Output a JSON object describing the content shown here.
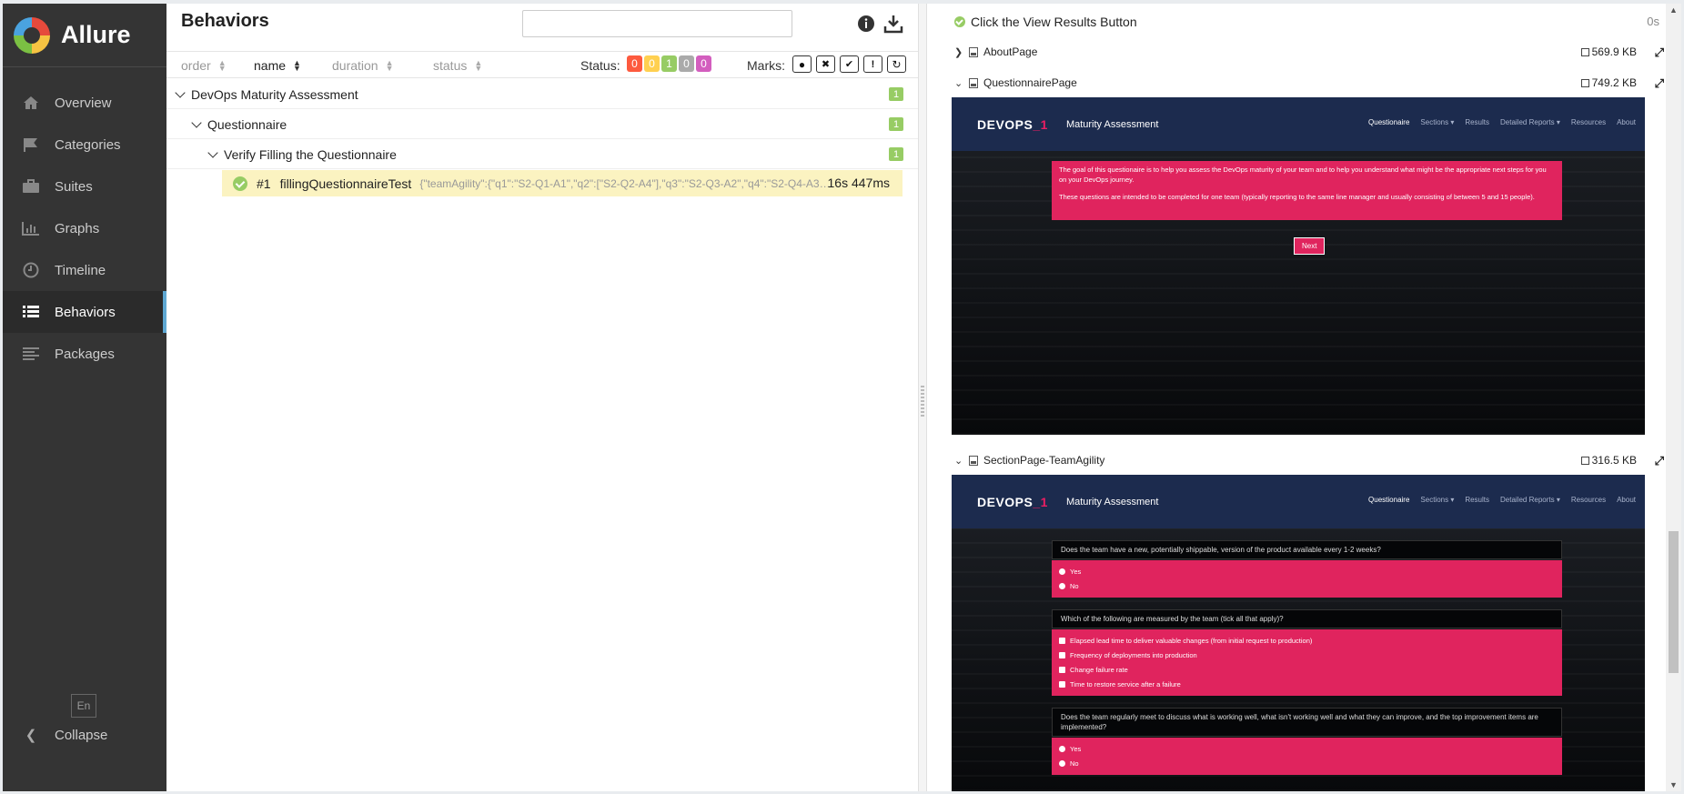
{
  "sidebar": {
    "brand": "Allure",
    "items": [
      {
        "label": "Overview",
        "icon": "home-icon"
      },
      {
        "label": "Categories",
        "icon": "flag-icon"
      },
      {
        "label": "Suites",
        "icon": "briefcase-icon"
      },
      {
        "label": "Graphs",
        "icon": "bar-chart-icon"
      },
      {
        "label": "Timeline",
        "icon": "clock-icon"
      },
      {
        "label": "Behaviors",
        "icon": "list-icon",
        "active": true
      },
      {
        "label": "Packages",
        "icon": "align-left-icon"
      }
    ],
    "language": "En",
    "collapse_label": "Collapse"
  },
  "behaviors": {
    "title": "Behaviors",
    "search": {
      "value": "",
      "placeholder": ""
    },
    "sort": {
      "order": "order",
      "name": "name",
      "duration": "duration",
      "status": "status"
    },
    "status_label": "Status:",
    "status_counts": [
      {
        "value": "0",
        "color": "#fd5a3e"
      },
      {
        "value": "0",
        "color": "#ffd050"
      },
      {
        "value": "1",
        "color": "#97cc64"
      },
      {
        "value": "0",
        "color": "#aaaaaa"
      },
      {
        "value": "0",
        "color": "#d35ebe"
      }
    ],
    "marks_label": "Marks:",
    "tree": {
      "epic": {
        "name": "DevOps Maturity Assessment",
        "count": "1"
      },
      "feature": {
        "name": "Questionnaire",
        "count": "1"
      },
      "story": {
        "name": "Verify Filling the Questionnaire",
        "count": "1"
      },
      "test": {
        "order": "#1",
        "name": "fillingQuestionnaireTest",
        "params": "{\"teamAgility\":{\"q1\":\"S2-Q1-A1\",\"q2\":[\"S2-Q2-A4\"],\"q3\":\"S2-Q3-A2\",\"q4\":\"S2-Q4-A3\",\"q...",
        "duration": "16s 447ms",
        "status": "passed"
      }
    }
  },
  "details": {
    "step": {
      "name": "Click the View Results Button",
      "duration": "0s"
    },
    "attachments": [
      {
        "name": "AboutPage",
        "size": "569.9 KB",
        "expanded": false
      },
      {
        "name": "QuestionnairePage",
        "size": "749.2 KB",
        "expanded": true
      },
      {
        "name": "SectionPage-TeamAgility",
        "size": "316.5 KB",
        "expanded": true
      }
    ],
    "screenshot": {
      "logo_main": "DEVOPS",
      "logo_accent": "_1",
      "app_title": "Maturity Assessment",
      "nav": [
        "Questionaire",
        "Sections ▾",
        "Results",
        "Detailed Reports ▾",
        "Resources",
        "About"
      ],
      "intro_p1": "The goal of this questionaire is to help you assess the DevOps maturity of your team and to help you understand what might be the appropriate next steps for you on your DevOps journey.",
      "intro_p2": "These questions are intended to be completed for one team (typically reporting to the same line manager and usually consisting of between 5 and 15 people).",
      "next_button": "Next",
      "q1": "Does the team have a new, potentially shippable, version of the product available every 1-2 weeks?",
      "q1_options": [
        "Yes",
        "No"
      ],
      "q2": "Which of the following are measured by the team (tick all that apply)?",
      "q2_options": [
        "Elapsed lead time to deliver valuable changes (from initial request to production)",
        "Frequency of deployments into production",
        "Change failure rate",
        "Time to restore service after a failure"
      ],
      "q3": "Does the team regularly meet to discuss what is working well, what isn't working well and what they can improve, and the top improvement items are implemented?",
      "q3_options": [
        "Yes",
        "No"
      ]
    }
  }
}
